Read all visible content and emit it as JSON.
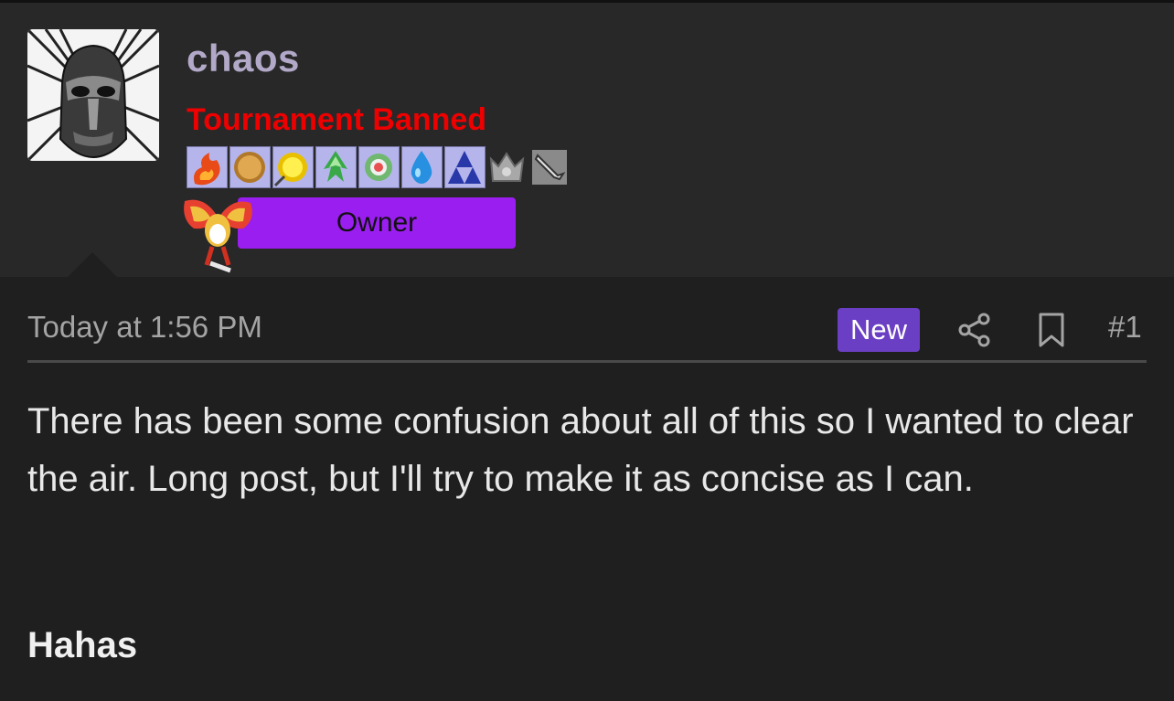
{
  "user": {
    "name": "chaos",
    "title": "Tournament Banned",
    "badges": [
      {
        "icon": "fire-badge-icon"
      },
      {
        "icon": "bronze-coin-badge-icon"
      },
      {
        "icon": "gold-coin-badge-icon"
      },
      {
        "icon": "green-leaf-badge-icon"
      },
      {
        "icon": "flower-badge-icon"
      },
      {
        "icon": "water-drop-badge-icon"
      },
      {
        "icon": "blue-triforce-badge-icon"
      },
      {
        "icon": "gray-crown-badge-icon"
      },
      {
        "icon": "gray-sword-badge-icon"
      }
    ],
    "role_label": "Owner",
    "role_sprite": "ho-oh-sprite-icon"
  },
  "post": {
    "timestamp": "Today at 1:56 PM",
    "new_label": "New",
    "post_number": "#1",
    "body": "There has been some confusion about all of this so I wanted to clear the air. Long post, but I'll try to make it as concise as I can.",
    "heading": "Hahas"
  },
  "colors": {
    "username": "#b2a9c9",
    "title_red": "#ee0000",
    "owner_purple": "#9a1ef0",
    "new_badge": "#6b3fc4",
    "background": "#1f1f1f",
    "header_bg": "#282828"
  }
}
